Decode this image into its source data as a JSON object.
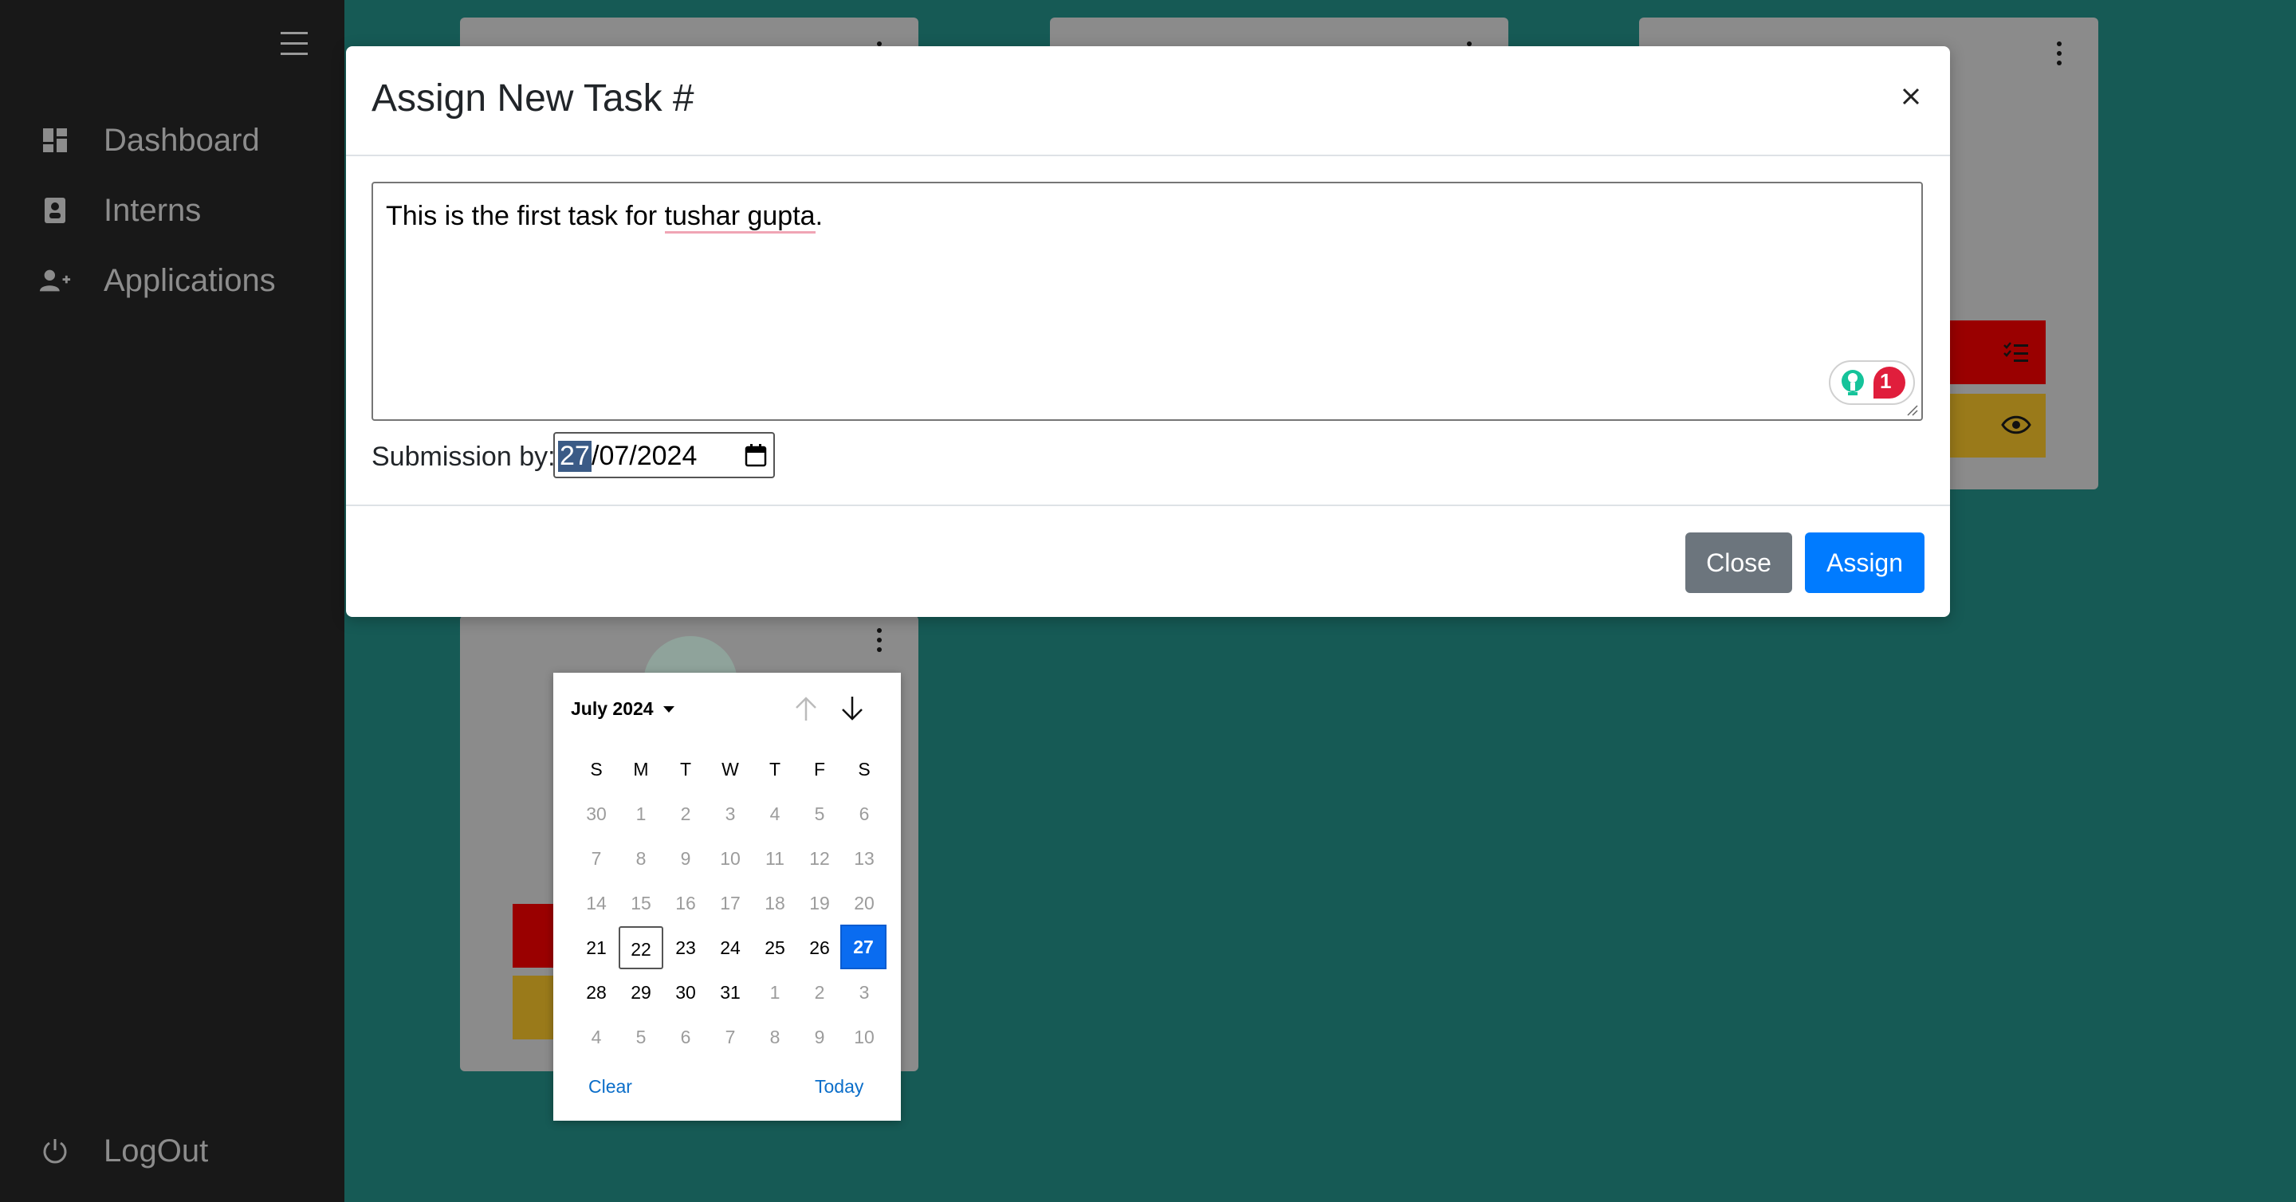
{
  "sidebar": {
    "items": [
      {
        "label": "Dashboard",
        "icon": "dashboard-icon"
      },
      {
        "label": "Interns",
        "icon": "badge-icon"
      },
      {
        "label": "Applications",
        "icon": "person-add-icon"
      }
    ],
    "logout_label": "LogOut"
  },
  "modal": {
    "title": "Assign New Task #",
    "task_text_before": "This is the first task for ",
    "task_text_flagged": "tushar gupta",
    "task_text_after": ".",
    "grammarly_count": "1",
    "submission_label": "Submission by:",
    "date_day": "27",
    "date_rest": "/07/2024",
    "close_label": "Close",
    "assign_label": "Assign"
  },
  "calendar": {
    "month_label": "July 2024",
    "weekdays": [
      "S",
      "M",
      "T",
      "W",
      "T",
      "F",
      "S"
    ],
    "weeks": [
      [
        "30",
        "1",
        "2",
        "3",
        "4",
        "5",
        "6"
      ],
      [
        "7",
        "8",
        "9",
        "10",
        "11",
        "12",
        "13"
      ],
      [
        "14",
        "15",
        "16",
        "17",
        "18",
        "19",
        "20"
      ],
      [
        "21",
        "22",
        "23",
        "24",
        "25",
        "26",
        "27"
      ],
      [
        "28",
        "29",
        "30",
        "31",
        "1",
        "2",
        "3"
      ],
      [
        "4",
        "5",
        "6",
        "7",
        "8",
        "9",
        "10"
      ]
    ],
    "clear_label": "Clear",
    "today_label": "Today"
  },
  "colors": {
    "sidebar_bg": "#181818",
    "page_bg": "#165a55",
    "primary": "#007bff",
    "secondary": "#6c757d",
    "card_red": "#9a0000",
    "card_yellow": "#9a7a1a"
  }
}
